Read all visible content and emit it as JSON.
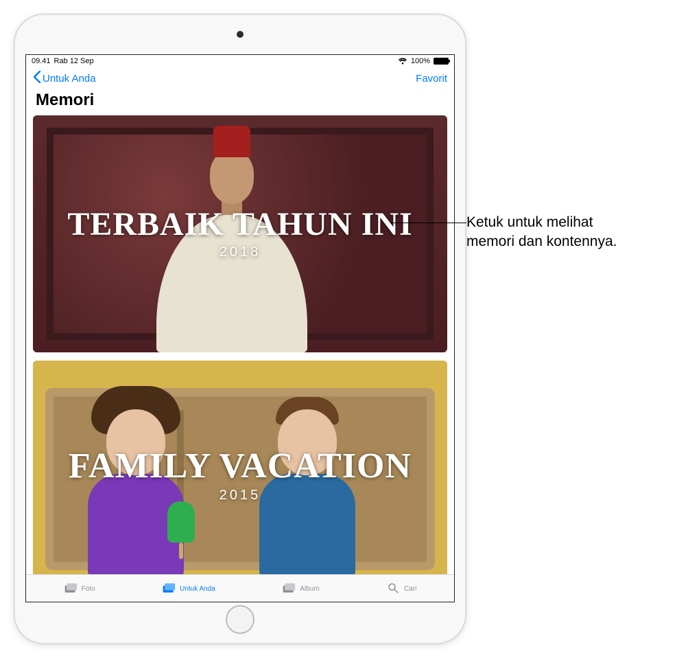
{
  "status": {
    "time": "09.41",
    "date": "Rab 12 Sep",
    "battery_pct": "100%"
  },
  "nav": {
    "back_label": "Untuk Anda",
    "right_label": "Favorit"
  },
  "page_title": "Memori",
  "memories": [
    {
      "title": "TERBAIK TAHUN INI",
      "subtitle": "2018"
    },
    {
      "title": "FAMILY VACATION",
      "subtitle": "2015"
    }
  ],
  "tabs": {
    "items": [
      {
        "label": "Foto"
      },
      {
        "label": "Untuk Anda"
      },
      {
        "label": "Album"
      },
      {
        "label": "Cari"
      }
    ]
  },
  "callout": {
    "line1": "Ketuk untuk melihat",
    "line2": "memori dan kontennya."
  }
}
